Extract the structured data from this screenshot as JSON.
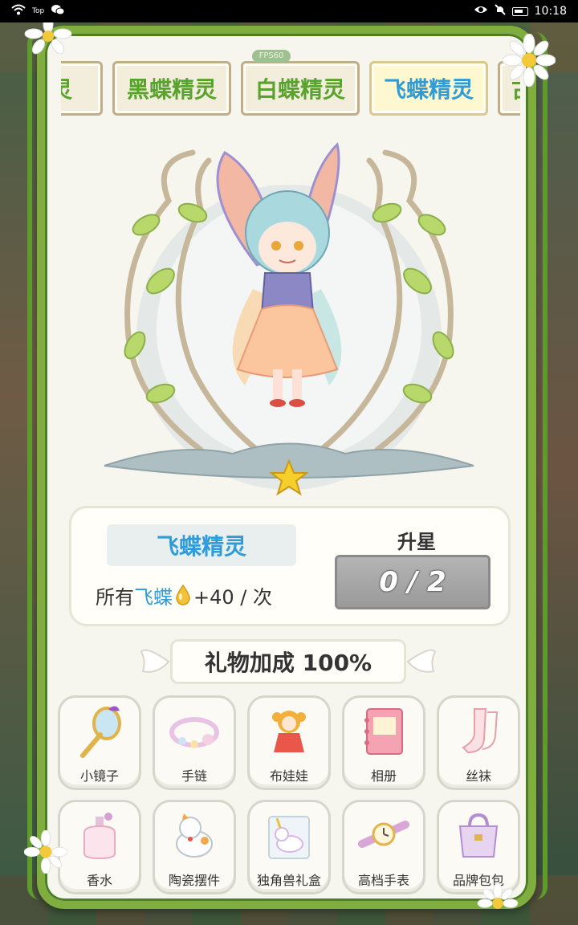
{
  "status_bar": {
    "top_label": "Top",
    "time": "10:18"
  },
  "fps": "FPS60",
  "tabs": [
    {
      "label": "精灵",
      "active": false
    },
    {
      "label": "黑蝶精灵",
      "active": false
    },
    {
      "label": "白蝶精灵",
      "active": false
    },
    {
      "label": "飞蝶精灵",
      "active": true
    },
    {
      "label": "古",
      "active": false
    }
  ],
  "spirit": {
    "name": "飞蝶精灵",
    "bonus_prefix": "所有",
    "bonus_target": "飞蝶",
    "bonus_value": "+40 / 次",
    "stars": 1
  },
  "upgrade": {
    "label": "升星",
    "progress": "0 / 2",
    "current": 0,
    "required": 2
  },
  "gift_bonus": "礼物加成 100%",
  "gifts": [
    {
      "label": "小镜子",
      "icon": "mirror-icon"
    },
    {
      "label": "手链",
      "icon": "bracelet-icon"
    },
    {
      "label": "布娃娃",
      "icon": "doll-icon"
    },
    {
      "label": "相册",
      "icon": "album-icon"
    },
    {
      "label": "丝袜",
      "icon": "stockings-icon"
    },
    {
      "label": "香水",
      "icon": "perfume-icon"
    },
    {
      "label": "陶瓷摆件",
      "icon": "ceramic-cat-icon"
    },
    {
      "label": "独角兽礼盒",
      "icon": "unicorn-box-icon"
    },
    {
      "label": "高档手表",
      "icon": "watch-icon"
    },
    {
      "label": "品牌包包",
      "icon": "handbag-icon"
    }
  ],
  "colors": {
    "accent_blue": "#2f9bd7",
    "accent_green": "#5aa22e",
    "vine": "#7fae3e"
  }
}
